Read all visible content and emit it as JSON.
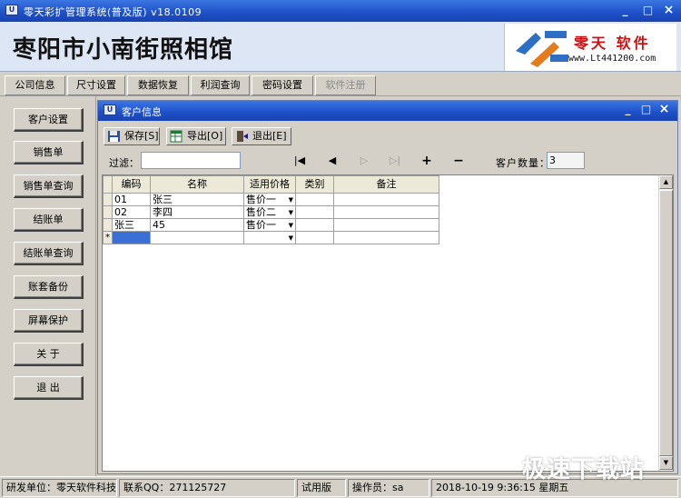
{
  "window": {
    "title": "零天彩扩管理系统(普及版)  v18.0109",
    "min": "_",
    "max": "□",
    "close": "×",
    "app_icon": "U"
  },
  "header": {
    "shop_name": "枣阳市小南街照相馆",
    "logo_brand": "零天 软件",
    "logo_url": "www.Lt441200.com"
  },
  "tabs": [
    {
      "label": "公司信息"
    },
    {
      "label": "尺寸设置"
    },
    {
      "label": "数据恢复"
    },
    {
      "label": "利润查询"
    },
    {
      "label": "密码设置"
    },
    {
      "label": "软件注册",
      "disabled": true
    }
  ],
  "sidebar": {
    "items": [
      {
        "label": "客户设置"
      },
      {
        "label": "销售单"
      },
      {
        "label": "销售单查询"
      },
      {
        "label": "结账单"
      },
      {
        "label": "结账单查询"
      },
      {
        "label": "账套备份"
      },
      {
        "label": "屏幕保护"
      },
      {
        "label": "关 于"
      },
      {
        "label": "退 出"
      }
    ]
  },
  "customer_window": {
    "title": "客户信息",
    "toolbar": {
      "save": "保存[S]",
      "export": "导出[O]",
      "exit": "退出[E]"
    },
    "filter_label": "过滤：",
    "filter_value": "",
    "nav": {
      "first": "|◀",
      "prev": "◀",
      "next": "▷",
      "last": "▷|",
      "add": "+",
      "remove": "−"
    },
    "count_label": "客户数量：",
    "count_value": "3",
    "grid": {
      "columns": [
        "编码",
        "名称",
        "适用价格",
        "类别",
        "备注"
      ],
      "rows": [
        {
          "code": "01",
          "name": "张三",
          "price": "售价一",
          "category": "",
          "note": ""
        },
        {
          "code": "02",
          "name": "李四",
          "price": "售价二",
          "category": "",
          "note": ""
        },
        {
          "code": "张三",
          "name": "45",
          "price": "售价一",
          "category": "",
          "note": ""
        }
      ],
      "new_row_marker": "*"
    }
  },
  "status": {
    "developer": "研发单位：零天软件科技",
    "contact": "联系QQ：271125727",
    "edition": "试用版",
    "operator": "操作员：sa",
    "datetime": "2018-10-19 9:36:15 星期五"
  },
  "watermark": "极速下载站",
  "colors": {
    "titlebar": "#1d4fc7",
    "brand_red": "#d01010",
    "selected_cell": "#3a6fd8"
  }
}
